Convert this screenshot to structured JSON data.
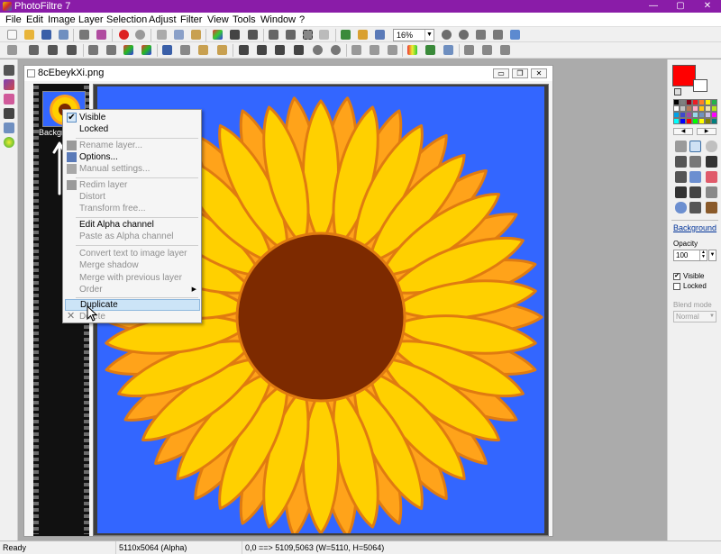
{
  "window": {
    "title": "PhotoFiltre 7",
    "controls": {
      "minimize": "—",
      "maximize": "▢",
      "close": "✕"
    }
  },
  "menubar": [
    "File",
    "Edit",
    "Image",
    "Layer",
    "Selection",
    "Adjust",
    "Filter",
    "View",
    "Tools",
    "Window",
    "?"
  ],
  "toolbar": {
    "zoom_value": "16%",
    "zoom_dropdown_icon": "chevron-down-icon"
  },
  "document": {
    "filename": "8cEbeykXi.png",
    "controls": {
      "minimize": "▭",
      "restore": "❐",
      "close": "✕"
    },
    "layer_label": "Backgro"
  },
  "context_menu": {
    "items": [
      {
        "label": "Visible",
        "state": "checked"
      },
      {
        "label": "Locked",
        "state": "enabled"
      },
      {
        "label": "Rename layer...",
        "state": "disabled",
        "icon": "rename-icon"
      },
      {
        "label": "Options...",
        "state": "enabled",
        "icon": "options-icon"
      },
      {
        "label": "Manual settings...",
        "state": "disabled",
        "icon": "settings-icon"
      },
      {
        "label": "Redim layer",
        "state": "disabled",
        "icon": "resize-icon"
      },
      {
        "label": "Distort",
        "state": "disabled"
      },
      {
        "label": "Transform free...",
        "state": "disabled"
      },
      {
        "label": "Edit Alpha channel",
        "state": "enabled"
      },
      {
        "label": "Paste as Alpha channel",
        "state": "disabled"
      },
      {
        "label": "Convert text to image layer",
        "state": "disabled"
      },
      {
        "label": "Merge shadow",
        "state": "disabled"
      },
      {
        "label": "Merge with previous layer",
        "state": "disabled"
      },
      {
        "label": "Order",
        "state": "disabled",
        "submenu": "▶"
      },
      {
        "label": "Duplicate",
        "state": "highlighted"
      },
      {
        "label": "Delete",
        "state": "disabled",
        "icon": "delete-x-icon"
      }
    ]
  },
  "right_panel": {
    "foreground_color": "#ff0000",
    "background_color": "#ffffff",
    "palette_nav": {
      "prev": "◀",
      "next": "▶"
    },
    "layer_name": "Background",
    "opacity_label": "Opacity",
    "opacity_value": "100",
    "visible_label": "Visible",
    "visible_checked": true,
    "locked_label": "Locked",
    "locked_checked": false,
    "blend_mode_label": "Blend mode",
    "blend_mode_value": "Normal"
  },
  "statusbar": {
    "state": "Ready",
    "image_size": "5110x5064 (Alpha)",
    "coordinates": "0,0 ==> 5109,5063 (W=5110, H=5064)"
  },
  "colors": {
    "titlebar": "#8a1ca8",
    "canvas_background": "#3366ff",
    "petal_light": "#ffd000",
    "petal_dark": "#ffa31a",
    "petal_outline": "#e07b10",
    "flower_center": "#7d2a00",
    "menu_highlight": "#cce4f7"
  }
}
